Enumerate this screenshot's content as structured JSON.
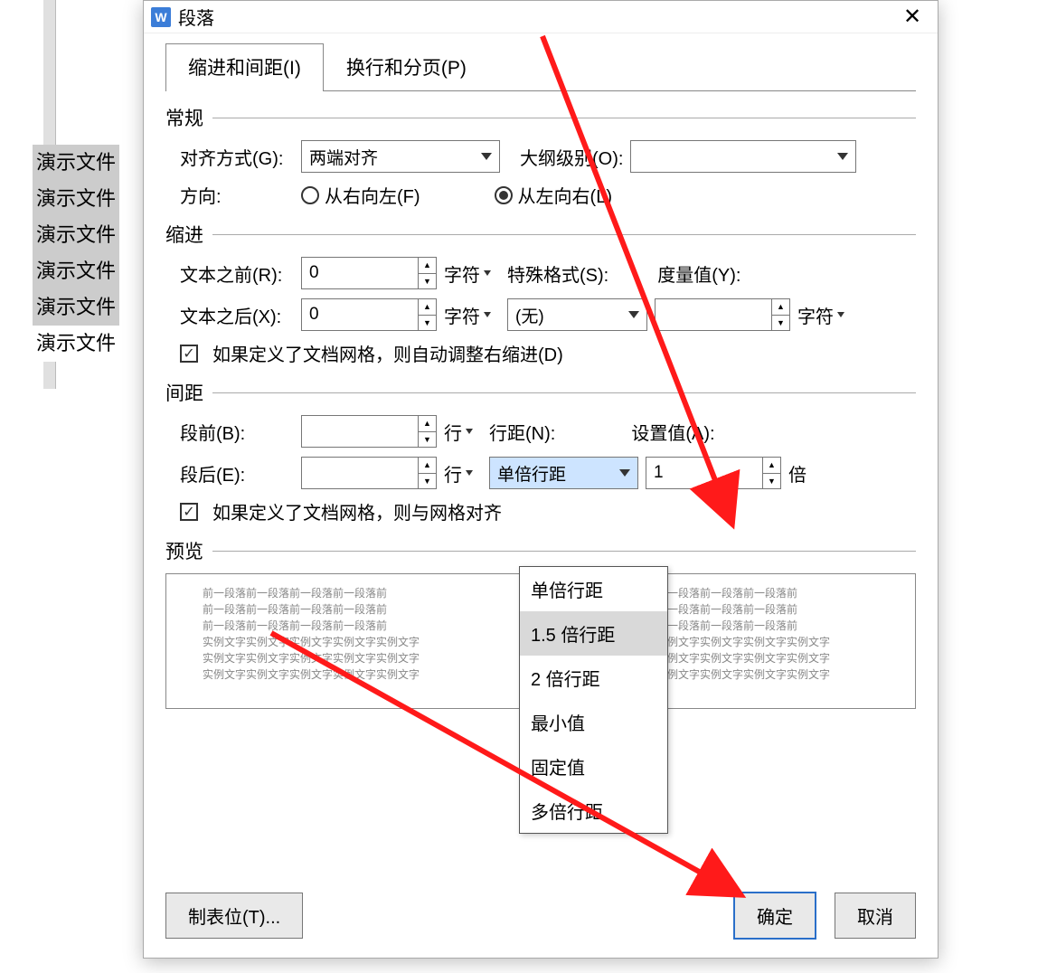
{
  "bg": {
    "lines": [
      "演示文件",
      "演示文件",
      "演示文件",
      "演示文件",
      "演示文件",
      "演示文件"
    ]
  },
  "dialog": {
    "title": "段落",
    "tabs": {
      "t1": "缩进和间距(I)",
      "t2": "换行和分页(P)"
    },
    "groups": {
      "general": "常规",
      "indent": "缩进",
      "spacing": "间距",
      "preview": "预览"
    },
    "general": {
      "align_label": "对齐方式(G):",
      "align_value": "两端对齐",
      "outline_label": "大纲级别(O):",
      "outline_value": "",
      "direction_label": "方向:",
      "dir_rtl": "从右向左(F)",
      "dir_ltr": "从左向右(L)"
    },
    "indent": {
      "before_label": "文本之前(R):",
      "before_value": "0",
      "before_unit": "字符",
      "after_label": "文本之后(X):",
      "after_value": "0",
      "after_unit": "字符",
      "special_label": "特殊格式(S):",
      "special_value": "(无)",
      "measure_label": "度量值(Y):",
      "measure_value": "",
      "measure_unit": "字符",
      "chk": "如果定义了文档网格，则自动调整右缩进(D)"
    },
    "spacing": {
      "before_label": "段前(B):",
      "before_value": "",
      "before_unit": "行",
      "after_label": "段后(E):",
      "after_value": "",
      "after_unit": "行",
      "line_label": "行距(N):",
      "line_value": "单倍行距",
      "setval_label": "设置值(A):",
      "setval_value": "1",
      "setval_unit": "倍",
      "chk": "如果定义了文档网格，则与网格对齐",
      "options": [
        "单倍行距",
        "1.5 倍行距",
        "2 倍行距",
        "最小值",
        "固定值",
        "多倍行距"
      ],
      "highlighted": "1.5 倍行距"
    },
    "preview": {
      "ghost": "前一段落前一段落前一段落前一段落前",
      "sample": "实例文字实例文字实例文字实例文字实例文字"
    },
    "buttons": {
      "tabs": "制表位(T)...",
      "ok": "确定",
      "cancel": "取消"
    }
  }
}
